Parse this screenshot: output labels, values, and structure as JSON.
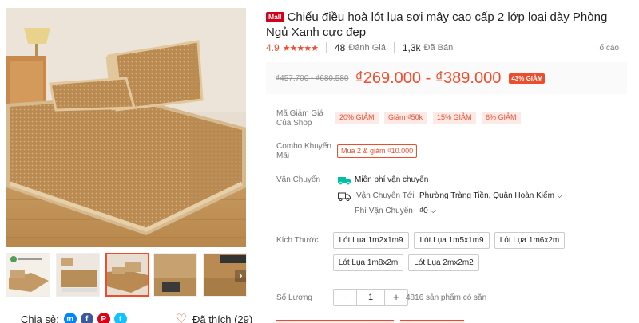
{
  "product": {
    "mall_badge": "Mall",
    "title": "Chiếu điều hoà lót lụa sợi mây cao cấp 2 lớp loại dày Phòng Ngủ Xanh cực đẹp"
  },
  "stats": {
    "rating": "4.9",
    "stars": "★★★★★",
    "reviews_count": "48",
    "reviews_label": "Đánh Giá",
    "sold_count": "1,3k",
    "sold_label": "Đã Bán",
    "report_label": "Tố cáo"
  },
  "price": {
    "original": "₫457.700 - ₫680.580",
    "current": "₫269.000 - ₫389.000",
    "discount": "43% GIẢM"
  },
  "vouchers": {
    "label": "Mã Giảm Giá Của Shop",
    "items": [
      "20% GIẢM",
      "Giảm ₫50k",
      "15% GIẢM",
      "6% GIẢM"
    ]
  },
  "combo": {
    "label": "Combo Khuyến Mãi",
    "value": "Mua 2 & giảm ₫10.000"
  },
  "shipping": {
    "label": "Vận Chuyển",
    "free_text": "Miễn phí vận chuyển",
    "to_label": "Vận Chuyển Tới",
    "to_value": "Phường Tràng Tiền, Quận Hoàn Kiếm",
    "fee_label": "Phí Vận Chuyển",
    "fee_value": "₫0"
  },
  "size": {
    "label": "Kích Thước",
    "options": [
      "Lót Lụa 1m2x1m9",
      "Lót Lụa 1m5x1m9",
      "Lót Lụa 1m6x2m",
      "Lót Lụa 1m8x2m",
      "Lót Lụa 2mx2m2"
    ]
  },
  "quantity": {
    "label": "Số Lượng",
    "value": "1",
    "minus": "−",
    "plus": "+",
    "stock": "4816 sản phẩm có sẵn"
  },
  "share": {
    "label": "Chia sẻ:",
    "liked": "Đã thích (29)"
  },
  "icons": {
    "messenger": "messenger-icon",
    "facebook": "facebook-icon",
    "pinterest": "pinterest-icon",
    "twitter": "twitter-icon",
    "heart": "heart-icon"
  },
  "colors": {
    "accent": "#ee4d2d",
    "mall": "#d0011b",
    "messenger": "#0084ff",
    "facebook": "#3b5999",
    "pinterest": "#de0217",
    "twitter": "#10c2ff"
  }
}
